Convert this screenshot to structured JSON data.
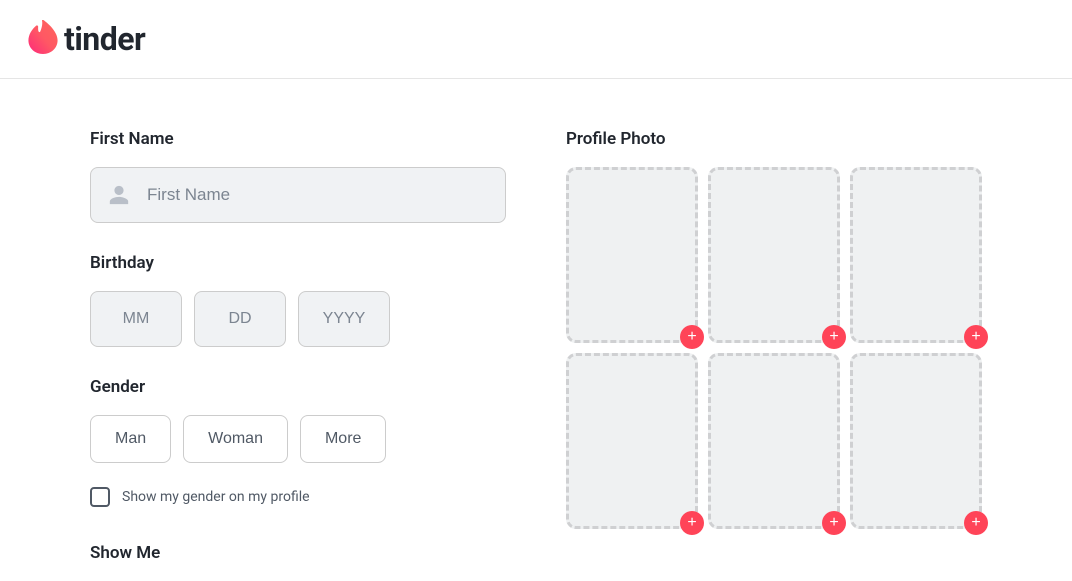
{
  "brand": {
    "name": "tinder"
  },
  "form": {
    "firstName": {
      "label": "First Name",
      "placeholder": "First Name",
      "value": ""
    },
    "birthday": {
      "label": "Birthday",
      "month": {
        "placeholder": "MM",
        "value": ""
      },
      "day": {
        "placeholder": "DD",
        "value": ""
      },
      "year": {
        "placeholder": "YYYY",
        "value": ""
      }
    },
    "gender": {
      "label": "Gender",
      "options": {
        "man": "Man",
        "woman": "Woman",
        "more": "More"
      },
      "showOnProfileLabel": "Show my gender on my profile"
    },
    "showMe": {
      "label": "Show Me"
    }
  },
  "photos": {
    "label": "Profile Photo",
    "addSymbol": "+"
  }
}
